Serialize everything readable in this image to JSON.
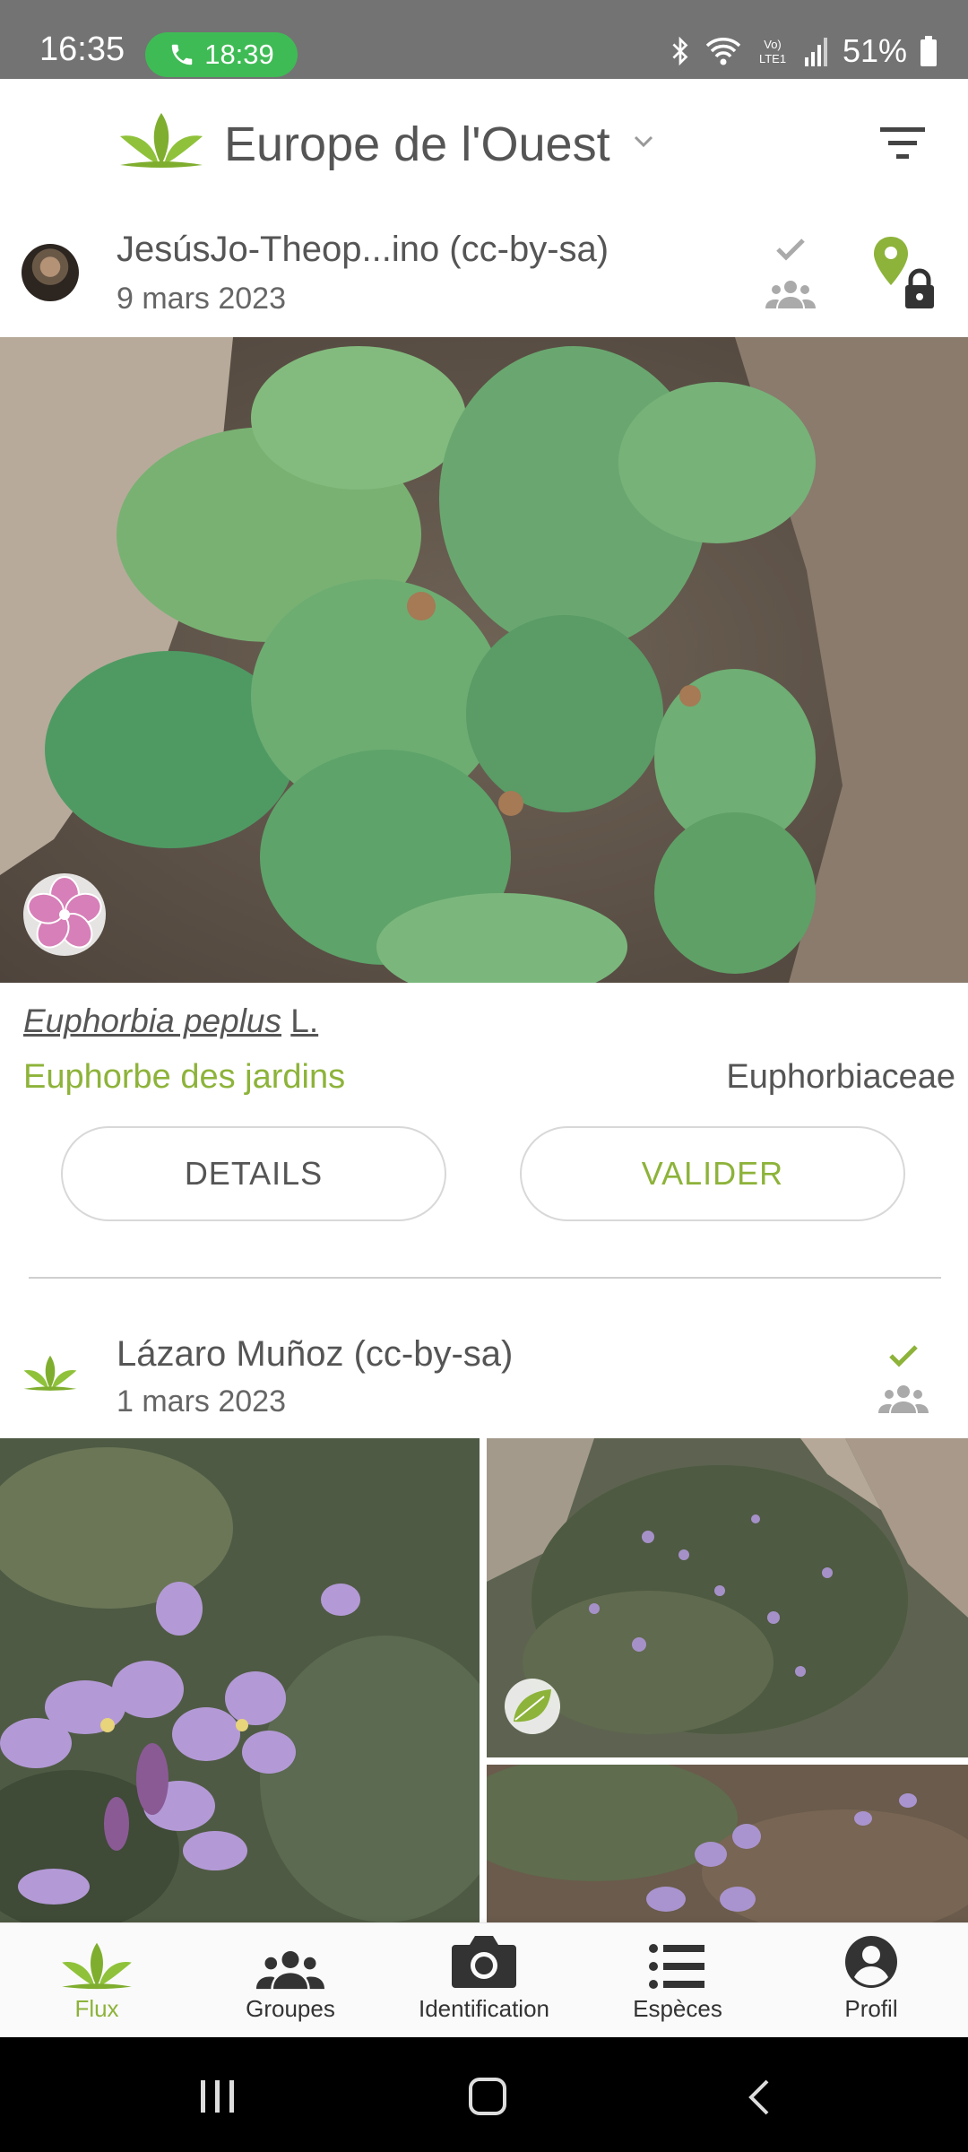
{
  "status_bar": {
    "time": "16:35",
    "call_timer": "18:39",
    "battery": "51%",
    "icons": [
      "bluetooth-icon",
      "wifi-icon",
      "volte-icon",
      "signal-icon",
      "battery-icon"
    ]
  },
  "header": {
    "region": "Europe de l'Ouest",
    "icons": [
      "plantnet-logo-icon",
      "chevron-down-icon",
      "filter-icon"
    ]
  },
  "posts": [
    {
      "author": "JesúsJo-Theop...ino (cc-by-sa)",
      "date": "9 mars 2023",
      "scientific_name": "Euphorbia peplus",
      "author_abbrev": "L.",
      "common_name": "Euphorbe des jardins",
      "family": "Euphorbiaceae",
      "details_label": "DETAILS",
      "validate_label": "VALIDER",
      "photo_organ": "flower-organ-icon"
    },
    {
      "author": "Lázaro Muñoz (cc-by-sa)",
      "date": "1 mars 2023",
      "photo_organ": "leaf-organ-icon"
    }
  ],
  "bottom_nav": {
    "items": [
      {
        "label": "Flux",
        "icon": "leaf-icon",
        "active": true
      },
      {
        "label": "Groupes",
        "icon": "group-icon",
        "active": false
      },
      {
        "label": "Identification",
        "icon": "camera-icon",
        "active": false
      },
      {
        "label": "Espèces",
        "icon": "list-icon",
        "active": false
      },
      {
        "label": "Profil",
        "icon": "account-icon",
        "active": false
      }
    ]
  },
  "colors": {
    "accent": "#8db33a",
    "call_badge": "#3fbb55",
    "status_bar": "#737373"
  }
}
